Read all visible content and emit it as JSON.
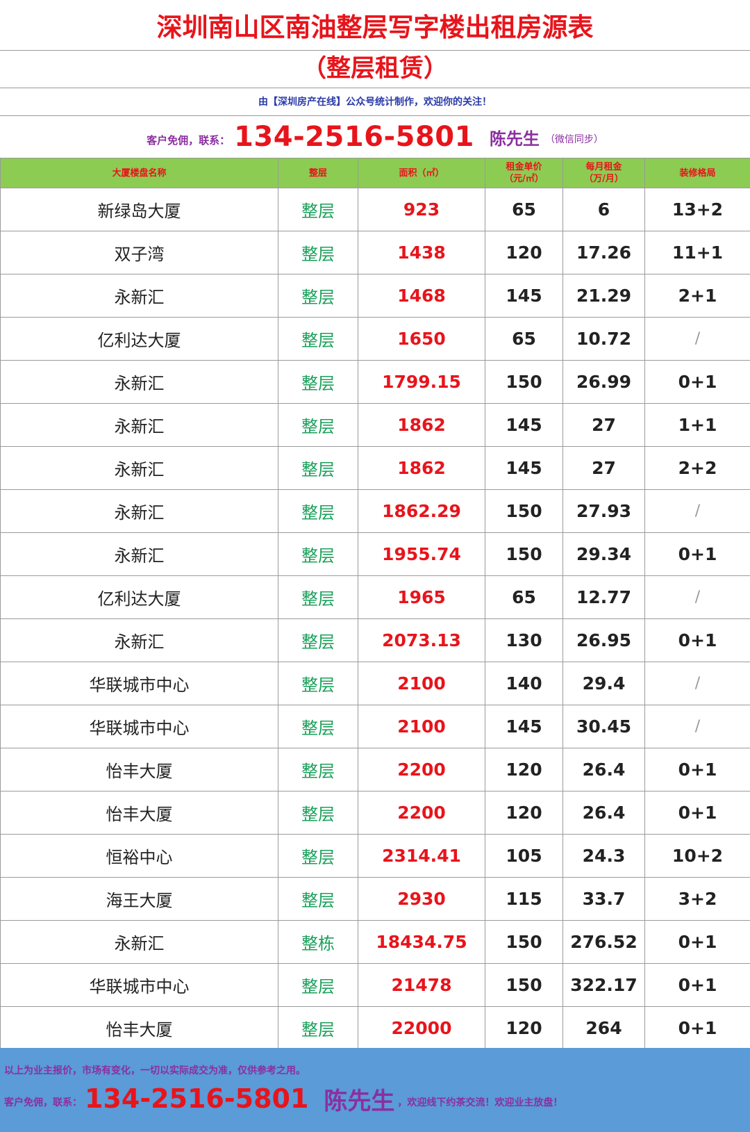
{
  "header": {
    "title": "深圳南山区南油整层写字楼出租房源表",
    "subtitle": "（整层租赁）",
    "source": "由【深圳房产在线】公众号统计制作，欢迎你的关注！",
    "contact_label": "客户免佣，联系：",
    "phone": "134-2516-5801",
    "name": "陈先生",
    "sync_note": "（微信同步）"
  },
  "table": {
    "columns": [
      {
        "line1": "大厦楼盘名称",
        "line2": ""
      },
      {
        "line1": "整层",
        "line2": ""
      },
      {
        "line1": "面积（㎡）",
        "line2": ""
      },
      {
        "line1": "租金单价",
        "line2": "（元/㎡）"
      },
      {
        "line1": "每月租金",
        "line2": "（万/月）"
      },
      {
        "line1": "装修格局",
        "line2": ""
      }
    ],
    "rows": [
      {
        "name": "新绿岛大厦",
        "type": "整层",
        "area": "923",
        "price": "65",
        "rent": "6",
        "layout": "13+2"
      },
      {
        "name": "双子湾",
        "type": "整层",
        "area": "1438",
        "price": "120",
        "rent": "17.26",
        "layout": "11+1"
      },
      {
        "name": "永新汇",
        "type": "整层",
        "area": "1468",
        "price": "145",
        "rent": "21.29",
        "layout": "2+1"
      },
      {
        "name": "亿利达大厦",
        "type": "整层",
        "area": "1650",
        "price": "65",
        "rent": "10.72",
        "layout": "/"
      },
      {
        "name": "永新汇",
        "type": "整层",
        "area": "1799.15",
        "price": "150",
        "rent": "26.99",
        "layout": "0+1"
      },
      {
        "name": "永新汇",
        "type": "整层",
        "area": "1862",
        "price": "145",
        "rent": "27",
        "layout": "1+1"
      },
      {
        "name": "永新汇",
        "type": "整层",
        "area": "1862",
        "price": "145",
        "rent": "27",
        "layout": "2+2"
      },
      {
        "name": "永新汇",
        "type": "整层",
        "area": "1862.29",
        "price": "150",
        "rent": "27.93",
        "layout": "/"
      },
      {
        "name": "永新汇",
        "type": "整层",
        "area": "1955.74",
        "price": "150",
        "rent": "29.34",
        "layout": "0+1"
      },
      {
        "name": "亿利达大厦",
        "type": "整层",
        "area": "1965",
        "price": "65",
        "rent": "12.77",
        "layout": "/"
      },
      {
        "name": "永新汇",
        "type": "整层",
        "area": "2073.13",
        "price": "130",
        "rent": "26.95",
        "layout": "0+1"
      },
      {
        "name": "华联城市中心",
        "type": "整层",
        "area": "2100",
        "price": "140",
        "rent": "29.4",
        "layout": "/"
      },
      {
        "name": "华联城市中心",
        "type": "整层",
        "area": "2100",
        "price": "145",
        "rent": "30.45",
        "layout": "/"
      },
      {
        "name": "怡丰大厦",
        "type": "整层",
        "area": "2200",
        "price": "120",
        "rent": "26.4",
        "layout": "0+1"
      },
      {
        "name": "怡丰大厦",
        "type": "整层",
        "area": "2200",
        "price": "120",
        "rent": "26.4",
        "layout": "0+1"
      },
      {
        "name": "恒裕中心",
        "type": "整层",
        "area": "2314.41",
        "price": "105",
        "rent": "24.3",
        "layout": "10+2"
      },
      {
        "name": "海王大厦",
        "type": "整层",
        "area": "2930",
        "price": "115",
        "rent": "33.7",
        "layout": "3+2"
      },
      {
        "name": "永新汇",
        "type": "整栋",
        "area": "18434.75",
        "price": "150",
        "rent": "276.52",
        "layout": "0+1"
      },
      {
        "name": "华联城市中心",
        "type": "整层",
        "area": "21478",
        "price": "150",
        "rent": "322.17",
        "layout": "0+1"
      },
      {
        "name": "怡丰大厦",
        "type": "整层",
        "area": "22000",
        "price": "120",
        "rent": "264",
        "layout": "0+1"
      }
    ]
  },
  "footer": {
    "note": "以上为业主报价，市场有变化，一切以实际成交为准，仅供参考之用。",
    "contact_label": "客户免佣，联系：",
    "phone": "134-2516-5801",
    "name": "陈先生",
    "tail": "，欢迎线下约茶交流！欢迎业主放盘！"
  },
  "colors": {
    "title_red": "#e8141b",
    "header_green": "#8ccc53",
    "type_green": "#1aa05a",
    "purple": "#8b2fa0",
    "footer_blue": "#5a9bd8",
    "source_blue": "#2a3aa8"
  }
}
